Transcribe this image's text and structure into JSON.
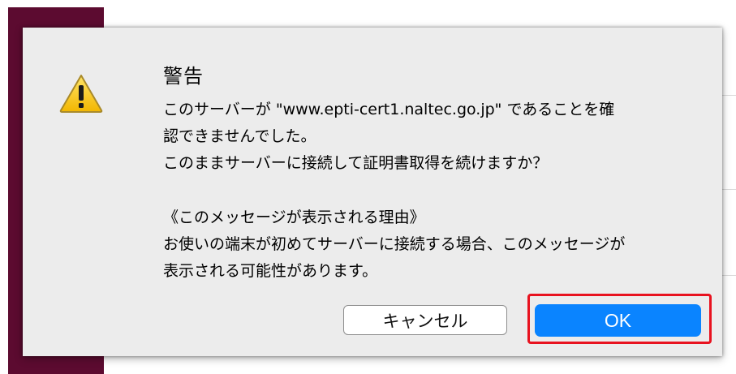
{
  "dialog": {
    "icon": "warning-triangle-icon",
    "title": "警告",
    "message_lines": [
      "このサーバーが \"www.epti-cert1.naltec.go.jp\" であることを確",
      "認できませんでした。",
      "このままサーバーに接続して証明書取得を続けますか？",
      "《このメッセージが表示される理由》",
      "お使いの端末が初めてサーバーに接続する場合、このメッセージが",
      "表示される可能性があります。"
    ],
    "cancel_label": "キャンセル",
    "ok_label": "OK"
  },
  "colors": {
    "sidebar": "#5c0b30",
    "dialog_bg": "#ececec",
    "ok_button": "#0a84ff",
    "highlight": "#e8121f"
  }
}
